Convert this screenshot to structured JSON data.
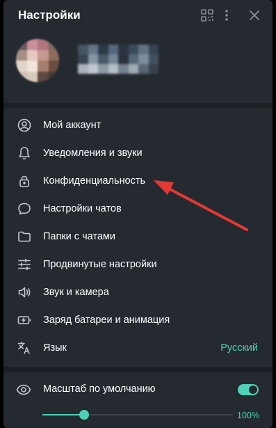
{
  "window": {
    "title": "Настройки"
  },
  "header": {
    "icons": [
      "qr-code-icon",
      "more-vertical-icon",
      "close-icon"
    ]
  },
  "menu": {
    "items": [
      {
        "label": "Мой аккаунт",
        "icon": "user-circle-icon"
      },
      {
        "label": "Уведомления и звуки",
        "icon": "bell-icon"
      },
      {
        "label": "Конфиденциальность",
        "icon": "lock-icon"
      },
      {
        "label": "Настройки чатов",
        "icon": "chat-bubble-icon"
      },
      {
        "label": "Папки с чатами",
        "icon": "folder-icon"
      },
      {
        "label": "Продвинутые настройки",
        "icon": "sliders-icon"
      },
      {
        "label": "Звук и камера",
        "icon": "speaker-icon"
      },
      {
        "label": "Заряд батареи и анимация",
        "icon": "battery-icon"
      },
      {
        "label": "Язык",
        "icon": "translate-icon",
        "value": "Русский"
      }
    ]
  },
  "zoom": {
    "label": "Масштаб по умолчанию",
    "icon": "eye-icon",
    "toggle_on": true,
    "slider_fraction": 0.22,
    "value": "100%"
  },
  "colors": {
    "accent": "#4fd1b5",
    "background": "#252a30",
    "separator": "#1c2025",
    "icon": "#c5c9cf",
    "arrow": "#e53935"
  }
}
